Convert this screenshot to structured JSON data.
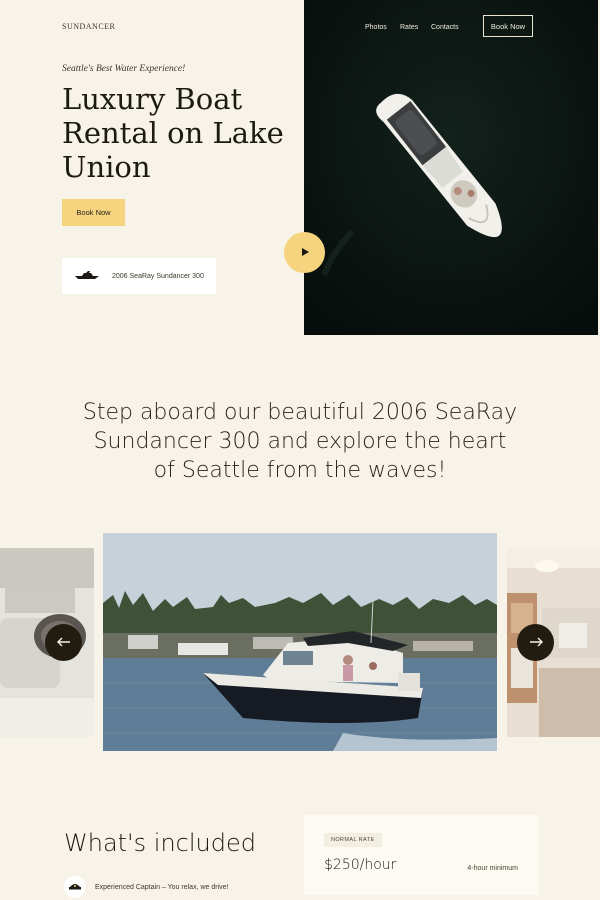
{
  "brand": "SUNDANCER",
  "nav": {
    "items": [
      "Photos",
      "Rates",
      "Contacts"
    ],
    "book_label": "Book Now"
  },
  "hero": {
    "tagline": "Seattle's Best Water Experience!",
    "title": "Luxury Boat Rental on Lake Union",
    "cta_label": "Book Now",
    "model": "2006 SeaRay Sundancer 300",
    "play_icon": "play-icon",
    "boat_icon": "boat-icon"
  },
  "statement": "Step aboard our beautiful 2006 SeaRay Sundancer 300 and explore the heart of Seattle from the waves!",
  "carousel": {
    "prev_icon": "arrow-left-icon",
    "next_icon": "arrow-right-icon"
  },
  "included": {
    "title": "What's included",
    "features": [
      {
        "icon": "captain-hat-icon",
        "text": "Experienced Captain – You relax, we drive!"
      }
    ]
  },
  "rate": {
    "badge": "NORMAL RATE",
    "price": "$250/hour",
    "minimum": "4-hour minimum"
  },
  "colors": {
    "background": "#f8f3e8",
    "accent": "#f6d47f",
    "dark": "#0c1613",
    "arrow": "#221b10"
  }
}
